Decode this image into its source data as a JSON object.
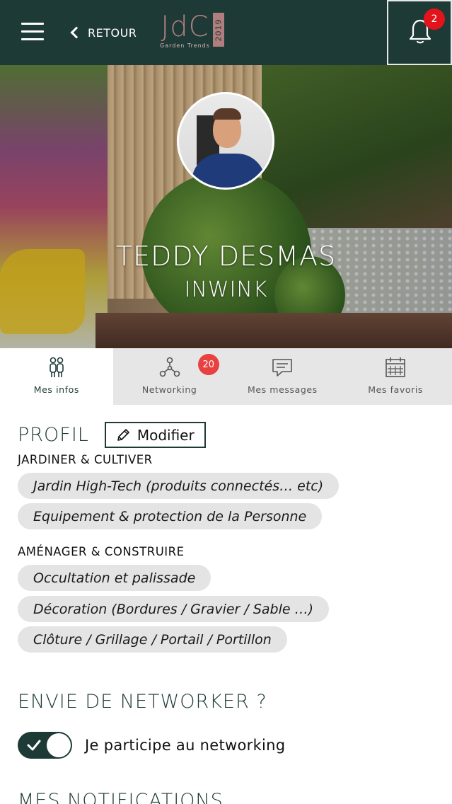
{
  "header": {
    "back_label": "RETOUR",
    "logo_text": "JdC",
    "logo_subtitle": "Garden Trends",
    "logo_year": "2019",
    "notification_count": "2",
    "bg_color": "#1d3a36",
    "accent_color": "#b07e7e"
  },
  "profile": {
    "name": "TEDDY DESMAS",
    "company": "INWINK"
  },
  "tabs": [
    {
      "label": "Mes infos",
      "icon": "people-icon",
      "active": true
    },
    {
      "label": "Networking",
      "icon": "network-icon",
      "badge": "20"
    },
    {
      "label": "Mes messages",
      "icon": "message-icon"
    },
    {
      "label": "Mes favoris",
      "icon": "calendar-icon"
    }
  ],
  "profil": {
    "title": "PROFIL",
    "modify_label": "Modifier",
    "categories": [
      {
        "title": "JARDINER & CULTIVER",
        "chips": [
          "Jardin High-Tech (produits connectés… etc)",
          "Equipement & protection de la Personne"
        ]
      },
      {
        "title": "AMÉNAGER & CONSTRUIRE",
        "chips": [
          "Occultation et palissade",
          "Décoration (Bordures / Gravier / Sable …)",
          "Clôture / Grillage / Portail / Portillon"
        ]
      }
    ]
  },
  "networking": {
    "title": "ENVIE DE NETWORKER ?",
    "toggle_label": "Je participe au networking",
    "toggle_on": true
  },
  "notifications": {
    "title": "MES NOTIFICATIONS"
  }
}
